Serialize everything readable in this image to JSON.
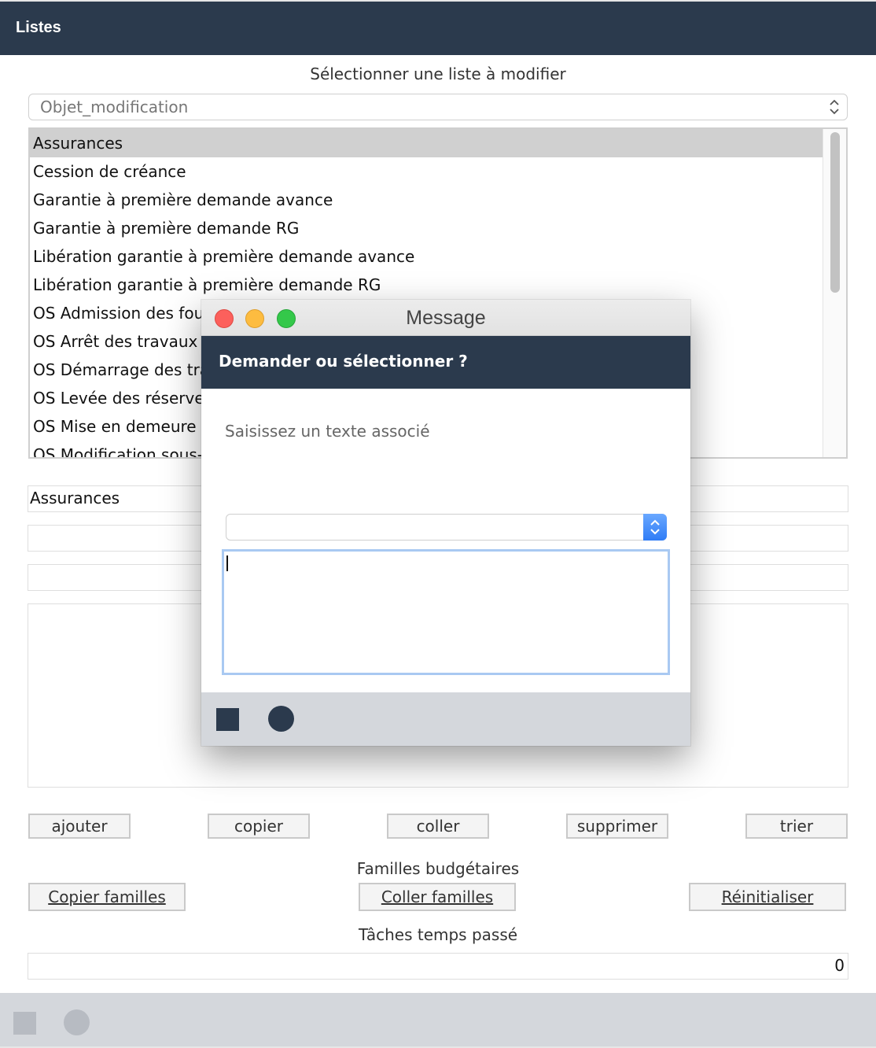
{
  "window": {
    "title": "Listes"
  },
  "list_selector": {
    "label": "Sélectionner une liste à modifier",
    "value": "Objet_modification"
  },
  "list": {
    "items": [
      "Assurances",
      "Cession de créance",
      "Garantie à première demande avance",
      "Garantie à première demande RG",
      "Libération garantie à première demande avance",
      "Libération garantie à première demande RG",
      "OS Admission des fou",
      "OS Arrêt des travaux",
      "OS Démarrage des tra",
      "OS Levée des réserves",
      "OS Mise en demeure",
      "OS Modification sous-"
    ],
    "selected_index": 0
  },
  "fields": {
    "name_value": "Assurances",
    "field2_value": "",
    "field3_value": "",
    "text_area_value": ""
  },
  "buttons": {
    "ajouter": "ajouter",
    "copier": "copier",
    "coller": "coller",
    "supprimer": "supprimer",
    "trier": "trier"
  },
  "familles": {
    "label": "Familles budgétaires",
    "copy_label": "Copier familles",
    "paste_label": "Coller familles",
    "reset_label": "Réinitialiser"
  },
  "taches": {
    "label": "Tâches temps passé",
    "value": "0"
  },
  "dialog": {
    "window_title": "Message",
    "header": "Demander ou sélectionner ?",
    "prompt": "Saisissez un texte associé",
    "select_value": "",
    "text_value": ""
  },
  "icons": {
    "stop": "stop-square-icon",
    "ok": "circle-icon"
  },
  "colors": {
    "header_bg": "#2b3a4d",
    "footer_bg": "#d4d7dc",
    "selection": "#d0d0d0",
    "focus_ring": "#a9c9f2",
    "select_accent": "#2f7cf6"
  }
}
